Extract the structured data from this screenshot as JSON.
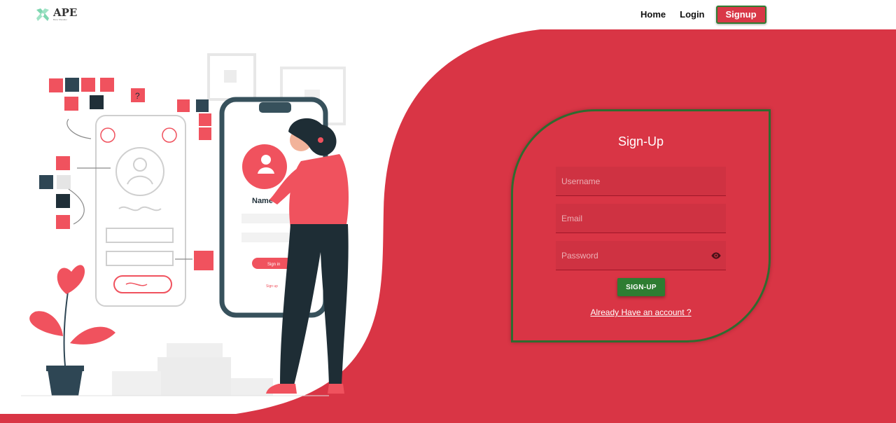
{
  "brand": {
    "name": "APE",
    "tagline": "Bone Shoulder",
    "accent_color": "#d93545",
    "success_color": "#2e7d32"
  },
  "nav": {
    "home": "Home",
    "login": "Login",
    "signup": "Signup"
  },
  "illustration": {
    "phone_name": "Name",
    "phone_button": "Sign in",
    "phone_link": "Sign up"
  },
  "form": {
    "title": "Sign-Up",
    "username_placeholder": "Username",
    "email_placeholder": "Email",
    "password_placeholder": "Password",
    "submit_label": "SIGN-UP",
    "account_link": "Already Have an account ?",
    "password_toggle_icon": "eye-icon"
  }
}
